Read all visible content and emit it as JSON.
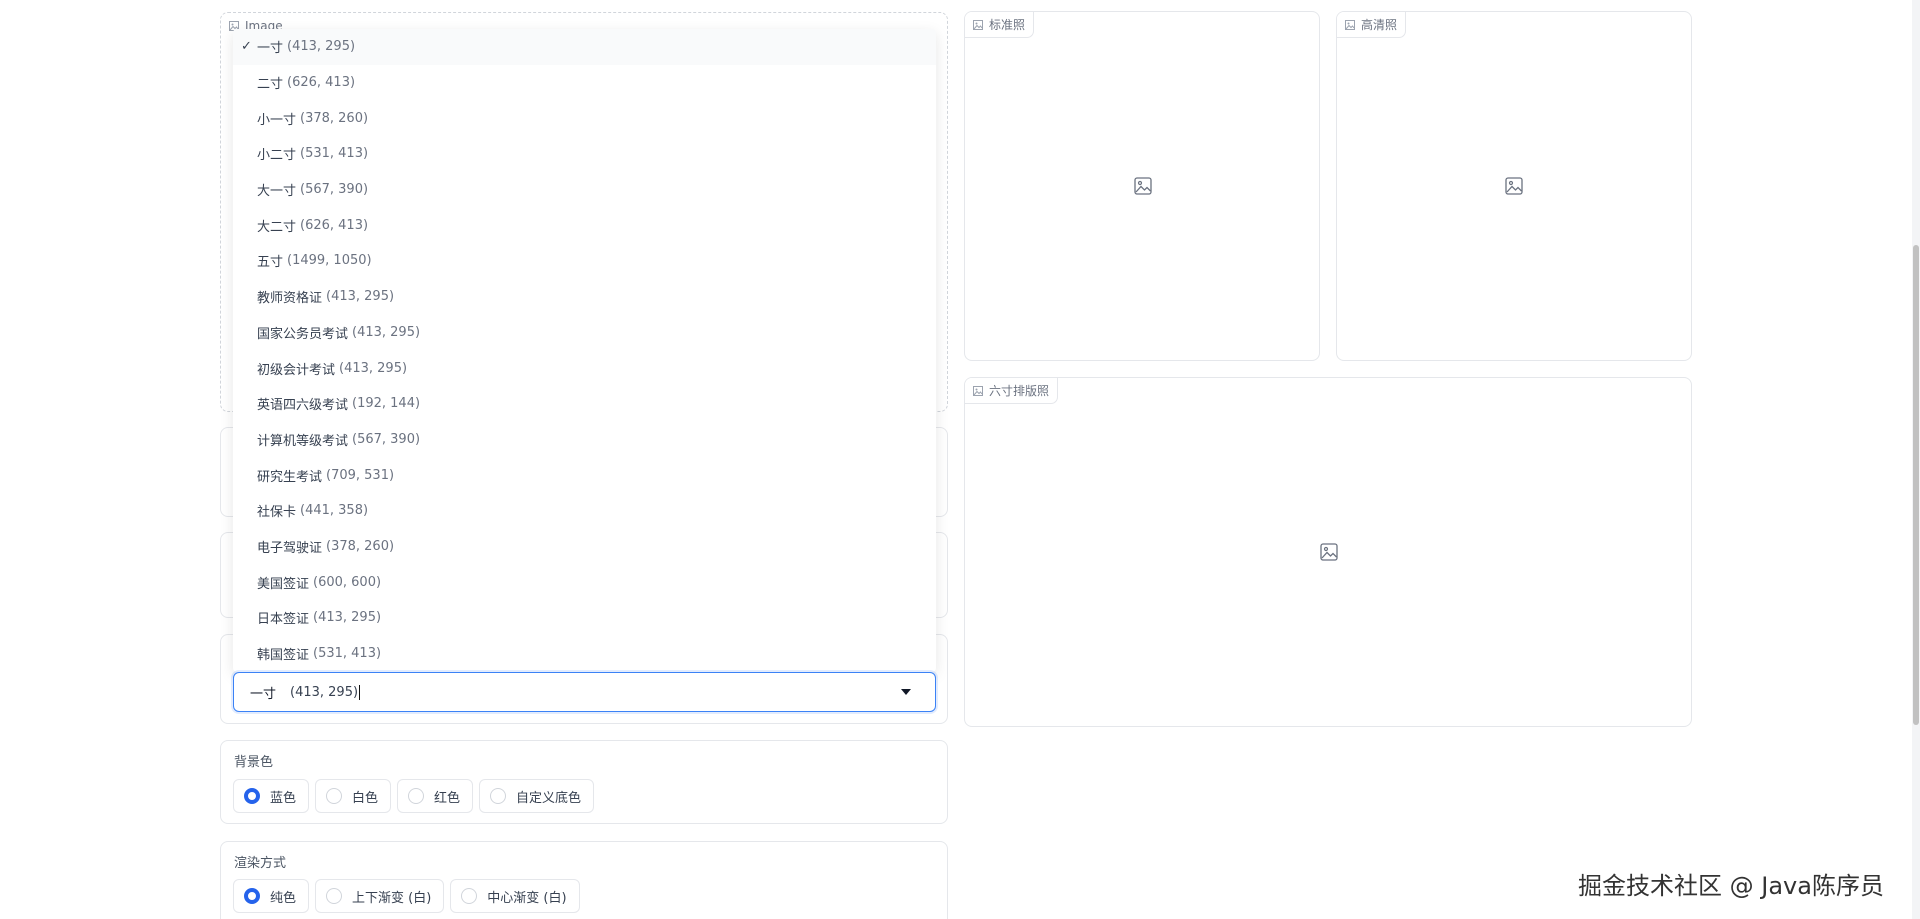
{
  "input_image": {
    "label": "Image"
  },
  "size_dropdown": {
    "selected_name": "一寸",
    "selected_size": "(413, 295)",
    "options": [
      {
        "name": "一寸",
        "size": "(413, 295)",
        "check": "✓"
      },
      {
        "name": "二寸",
        "size": "(626, 413)"
      },
      {
        "name": "小一寸",
        "size": "(378, 260)"
      },
      {
        "name": "小二寸",
        "size": "(531, 413)"
      },
      {
        "name": "大一寸",
        "size": "(567, 390)"
      },
      {
        "name": "大二寸",
        "size": "(626, 413)"
      },
      {
        "name": "五寸",
        "size": "(1499, 1050)"
      },
      {
        "name": "教师资格证",
        "size": "(413, 295)"
      },
      {
        "name": "国家公务员考试",
        "size": "(413, 295)"
      },
      {
        "name": "初级会计考试",
        "size": "(413, 295)"
      },
      {
        "name": "英语四六级考试",
        "size": "(192, 144)"
      },
      {
        "name": "计算机等级考试",
        "size": "(567, 390)"
      },
      {
        "name": "研究生考试",
        "size": "(709, 531)"
      },
      {
        "name": "社保卡",
        "size": "(441, 358)"
      },
      {
        "name": "电子驾驶证",
        "size": "(378, 260)"
      },
      {
        "name": "美国签证",
        "size": "(600, 600)"
      },
      {
        "name": "日本签证",
        "size": "(413, 295)"
      },
      {
        "name": "韩国签证",
        "size": "(531, 413)"
      }
    ]
  },
  "background_color": {
    "title": "背景色",
    "options": [
      "蓝色",
      "白色",
      "红色",
      "自定义底色"
    ],
    "selected": "蓝色"
  },
  "render_mode": {
    "title": "渲染方式",
    "options": [
      "纯色",
      "上下渐变 (白)",
      "中心渐变 (白)"
    ],
    "selected": "纯色"
  },
  "outputs": {
    "standard": "标准照",
    "hd": "高清照",
    "layout": "六寸排版照"
  },
  "watermark": "掘金技术社区 @ Java陈序员",
  "colors": {
    "accent": "#2563eb",
    "focus_border": "#3b82f6"
  }
}
